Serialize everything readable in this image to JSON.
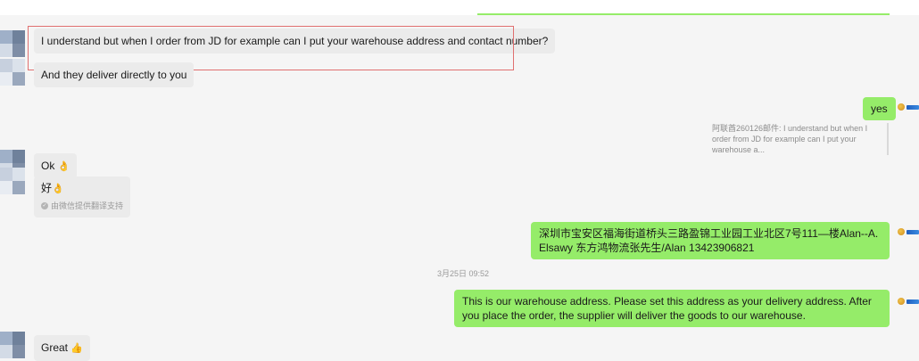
{
  "messages": {
    "m1": "I understand but when I order from JD for example can I put your warehouse address and contact number?",
    "m2": "And they deliver directly to you",
    "m3": "yes",
    "m3_quote": "阿联酋260126邮件: I understand but when I order from JD for example can I put your warehouse a...",
    "m4_text": "Ok",
    "m4_emoji": "👌",
    "m5_text": "好",
    "m5_emoji": "👌",
    "m5_note": "由微信提供翻译支持",
    "m6": "深圳市宝安区福海街道桥头三路盈锦工业园工业北区7号111—楼Alan--A. Elsawy 东方鸿物流张先生/Alan   13423906821",
    "m7": "This is our warehouse address. Please set this address as your delivery address. After you place the order, the supplier will deliver the goods to our warehouse.",
    "m8_text": "Great",
    "m8_emoji": "👍"
  },
  "timestamp": "3月25日 09:52",
  "icons": {
    "contact_avatar": "blurred-avatar",
    "self_avatar": "company-logo-avatar",
    "translate_note_icon": "check-circle-icon"
  },
  "colors": {
    "incoming_bubble": "#ebebeb",
    "outgoing_bubble": "#95ec69",
    "highlight_box": "#e07070",
    "background": "#f5f5f5"
  }
}
